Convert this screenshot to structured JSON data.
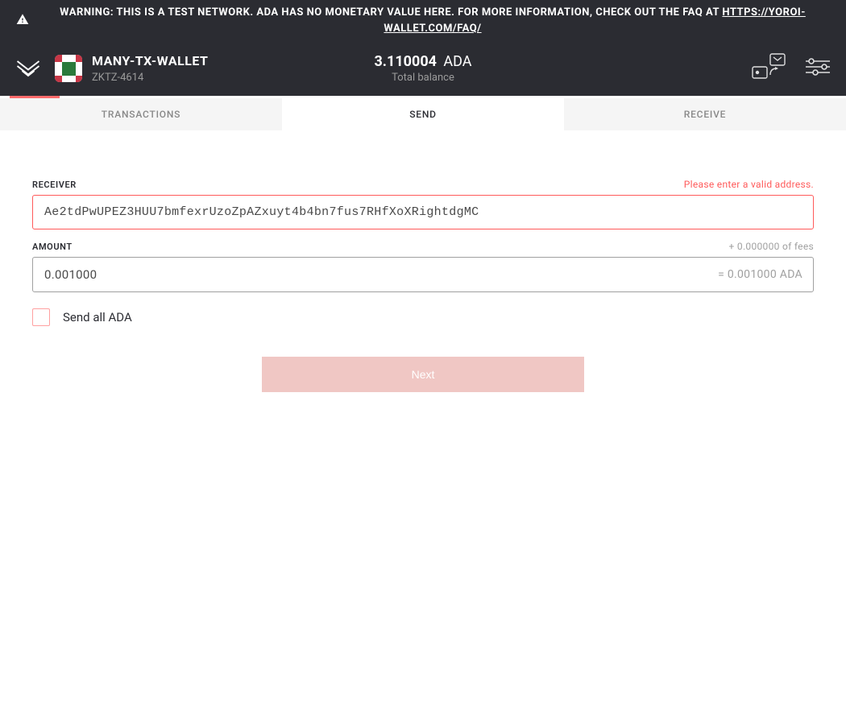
{
  "warning": {
    "text": "WARNING: THIS IS A TEST NETWORK. ADA HAS NO MONETARY VALUE HERE. FOR MORE INFORMATION, CHECK OUT THE FAQ AT ",
    "link": "HTTPS://YOROI-WALLET.COM/FAQ/"
  },
  "header": {
    "wallet_name": "MANY-TX-WALLET",
    "wallet_id": "ZKTZ-4614",
    "balance_value": "3.110004",
    "balance_currency": "ADA",
    "balance_label": "Total balance"
  },
  "tabs": {
    "transactions": "TRANSACTIONS",
    "send": "SEND",
    "receive": "RECEIVE"
  },
  "form": {
    "receiver_label": "RECEIVER",
    "receiver_error": "Please enter a valid address.",
    "receiver_value": "Ae2tdPwUPEZ3HUU7bmfexrUzoZpAZxuyt4b4bn7fus7RHfXoXRightdgMC",
    "amount_label": "AMOUNT",
    "fees_hint": "+ 0.000000 of fees",
    "amount_value": "0.001000",
    "amount_equals": "= 0.001000 ADA",
    "send_all_label": "Send all ADA",
    "next_button": "Next"
  },
  "colors": {
    "dark_bg": "#2b2c32",
    "error": "#ff5a5a",
    "accent": "#ff6b6b",
    "disabled_button": "#f0c7c4",
    "muted": "#a0a0a0"
  }
}
